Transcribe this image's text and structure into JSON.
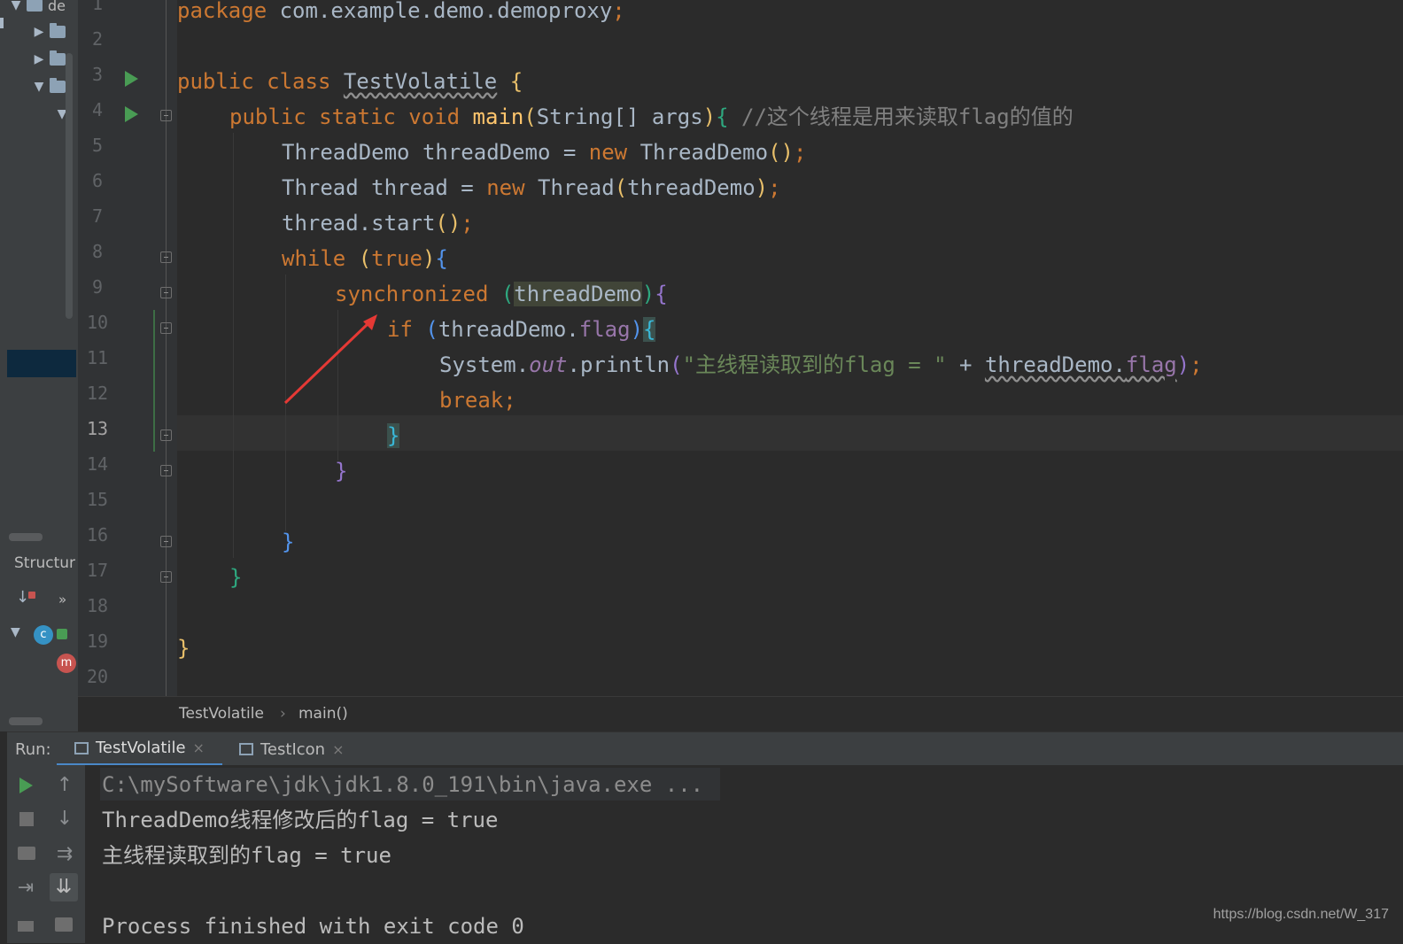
{
  "project_tree": {
    "root_label": "de"
  },
  "structure_panel": {
    "title": "Structur",
    "more_glyph": "»"
  },
  "editor": {
    "line_numbers": [
      "1",
      "2",
      "3",
      "4",
      "5",
      "6",
      "7",
      "8",
      "9",
      "10",
      "11",
      "12",
      "13",
      "14",
      "15",
      "16",
      "17",
      "18",
      "19",
      "20"
    ],
    "current_line": "13",
    "code": {
      "l1_package": "package",
      "l1_name": " com.example.demo.demoproxy",
      "l1_semi": ";",
      "l3_public": "public",
      "l3_class": "class",
      "l3_name": "TestVolatile",
      "l3_brace": "{",
      "l4_mods": "public static void",
      "l4_main": "main",
      "l4_open": "(",
      "l4_params": "String[] args",
      "l4_close": ")",
      "l4_brace": "{",
      "l4_comment": "//这个线程是用来读取flag的值的",
      "l5_type": "ThreadDemo threadDemo = ",
      "l5_new": "new",
      "l5_ctor": " ThreadDemo",
      "l5_parens": "()",
      "l5_semi": ";",
      "l6_type": "Thread thread = ",
      "l6_new": "new",
      "l6_ctor": " Thread",
      "l6_open": "(",
      "l6_arg": "threadDemo",
      "l6_close": ")",
      "l6_semi": ";",
      "l7_call": "thread.start",
      "l7_parens": "()",
      "l7_semi": ";",
      "l8_while": "while",
      "l8_open": "(",
      "l8_true": "true",
      "l8_close": ")",
      "l8_brace": "{",
      "l9_sync": "synchronized",
      "l9_open": "(",
      "l9_arg": "threadDemo",
      "l9_close": ")",
      "l9_brace": "{",
      "l10_if": "if",
      "l10_open": "(",
      "l10_obj": "threadDemo.",
      "l10_field": "flag",
      "l10_close": ")",
      "l10_brace": "{",
      "l11_system": "System.",
      "l11_out": "out",
      "l11_println": ".println",
      "l11_open": "(",
      "l11_string": "\"主线程读取到的flag = \"",
      "l11_plus": " + ",
      "l11_obj": "threadDemo.",
      "l11_field": "flag",
      "l11_close": ")",
      "l11_semi": ";",
      "l12_break": "break;",
      "l13_brace": "}",
      "l14_brace": "}",
      "l16_brace": "}",
      "l17_brace": "}",
      "l19_brace": "}"
    }
  },
  "breadcrumb": {
    "class": "TestVolatile",
    "separator": "›",
    "method": "main()"
  },
  "run_window": {
    "label": "Run:",
    "tabs": [
      {
        "label": "TestVolatile",
        "close": "×"
      },
      {
        "label": "TestIcon",
        "close": "×"
      }
    ],
    "console_lines": [
      "C:\\mySoftware\\jdk\\jdk1.8.0_191\\bin\\java.exe ...",
      "ThreadDemo线程修改后的flag = true",
      "主线程读取到的flag = true",
      "",
      "Process finished with exit code 0"
    ]
  },
  "watermark": "https://blog.csdn.net/W_317",
  "colors": {
    "keyword": "#cc7832",
    "string": "#6a8759",
    "comment": "#808080",
    "field": "#9876aa",
    "method": "#ffc66d",
    "run_green": "#499c54",
    "annotation_arrow": "#e53935"
  }
}
